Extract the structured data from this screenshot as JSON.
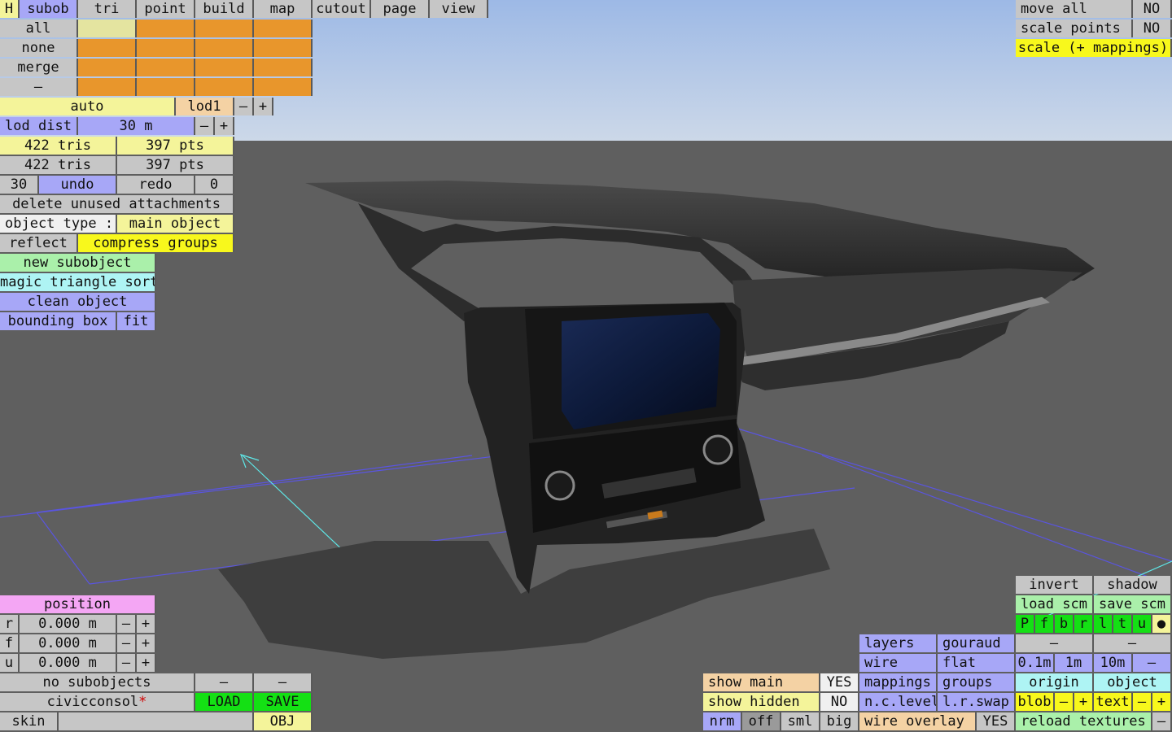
{
  "menu_tabs": [
    "H",
    "subob",
    "tri",
    "point",
    "build",
    "map",
    "cutout",
    "page",
    "view"
  ],
  "sel": {
    "all": "all",
    "none": "none",
    "merge": "merge",
    "dash": "–"
  },
  "lod": {
    "auto": "auto",
    "name": "lod1",
    "minus": "–",
    "plus": "+",
    "dist_label": "lod dist",
    "dist_value": "30 m"
  },
  "stats": {
    "tris1": "422 tris",
    "pts1": "397 pts",
    "tris2": "422 tris",
    "pts2": "397 pts"
  },
  "undo": {
    "count": "30",
    "undo": "undo",
    "redo": "redo",
    "redo_count": "0"
  },
  "actions": {
    "delete_unused": "delete unused attachments",
    "object_type_label": "object type :",
    "object_type_value": "main object",
    "reflect": "reflect",
    "compress": "compress groups",
    "new_subobject": "new subobject",
    "magic_sort": "magic triangle sort",
    "clean_object": "clean object",
    "bounding_box": "bounding box",
    "fit": "fit"
  },
  "position": {
    "title": "position",
    "rows": [
      {
        "axis": "r",
        "value": "0.000 m"
      },
      {
        "axis": "f",
        "value": "0.000 m"
      },
      {
        "axis": "u",
        "value": "0.000 m"
      }
    ],
    "minus": "–",
    "plus": "+"
  },
  "bottom_left": {
    "no_subobjects": "no subobjects",
    "dash": "–",
    "filename": "civicconsol",
    "modified_mark": "*",
    "load": "LOAD",
    "save": "SAVE",
    "skin": "skin",
    "obj": "OBJ"
  },
  "top_right": {
    "move_all": "move all",
    "move_all_val": "NO",
    "scale_points": "scale points",
    "scale_points_val": "NO",
    "scale_mappings": "scale (+ mappings)"
  },
  "show": {
    "show_main": "show main",
    "show_main_val": "YES",
    "show_hidden": "show hidden",
    "show_hidden_val": "NO",
    "nrm": "nrm",
    "off": "off",
    "sml": "sml",
    "big": "big"
  },
  "render": {
    "layers": "layers",
    "gouraud": "gouraud",
    "wire": "wire",
    "flat": "flat",
    "mappings": "mappings",
    "groups": "groups",
    "nclevel": "n.c.level",
    "lrswap": "l.r.swap",
    "wire_overlay": "wire overlay",
    "wire_overlay_val": "YES"
  },
  "bottom_right": {
    "invert": "invert",
    "shadow": "shadow",
    "load_scm": "load scm",
    "save_scm": "save scm",
    "letters": [
      "P",
      "f",
      "b",
      "r",
      "l",
      "t",
      "u"
    ],
    "dot": "●",
    "dash": "–",
    "d01": "0.1m",
    "d1": "1m",
    "d10": "10m",
    "origin": "origin",
    "object": "object",
    "blob": "blob",
    "text": "text",
    "plus": "+",
    "reload": "reload textures"
  },
  "colors": {
    "sky_top": "#9fbbe8",
    "sky_bottom": "#c6d4e8",
    "ground": "#5f5f5f",
    "grid": "#5a55e0",
    "axis": "#5ee8e8"
  }
}
